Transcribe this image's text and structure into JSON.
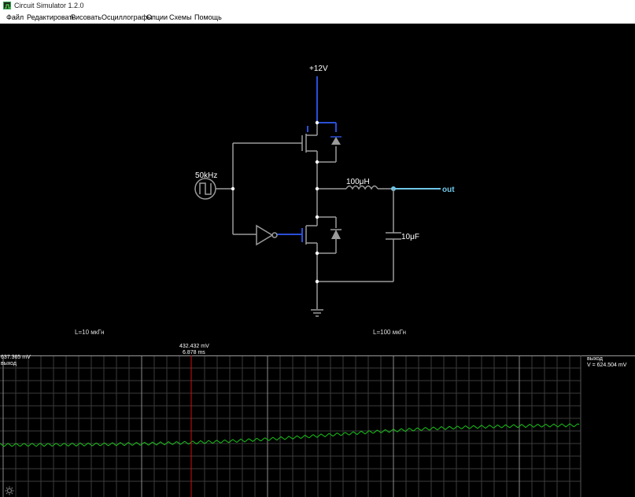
{
  "window": {
    "title": "Circuit Simulator 1.2.0",
    "icon": "circuit-app-icon"
  },
  "menu": [
    {
      "id": "file",
      "label": "Файл"
    },
    {
      "id": "edit",
      "label": "Редактировать"
    },
    {
      "id": "draw",
      "label": "Рисовать"
    },
    {
      "id": "scopes",
      "label": "Осциллографы"
    },
    {
      "id": "options",
      "label": "Опции"
    },
    {
      "id": "circuits",
      "label": "Схемы"
    },
    {
      "id": "help",
      "label": "Помощь"
    }
  ],
  "circuit": {
    "supply_label": "+12V",
    "source_label": "50kHz",
    "inductor_label": "100μH",
    "capacitor_label": "10μF",
    "output_label": "out",
    "colors": {
      "wire": "#9a9a9a",
      "active": "#2a4fd8",
      "output": "#6ec7e8",
      "text": "#ffffff"
    }
  },
  "labels": {
    "left": "L=10 мкГн",
    "right": "L=100 мкГн"
  },
  "scope": {
    "left_value": "637.365 mV",
    "left_name": "выход",
    "cursor_value": "432.432 mV",
    "cursor_time": "6.878 ms",
    "right_name": "выход",
    "right_value": "V = 624.504 mV",
    "trace_color": "#19c219",
    "cursor_color": "#d01010"
  }
}
